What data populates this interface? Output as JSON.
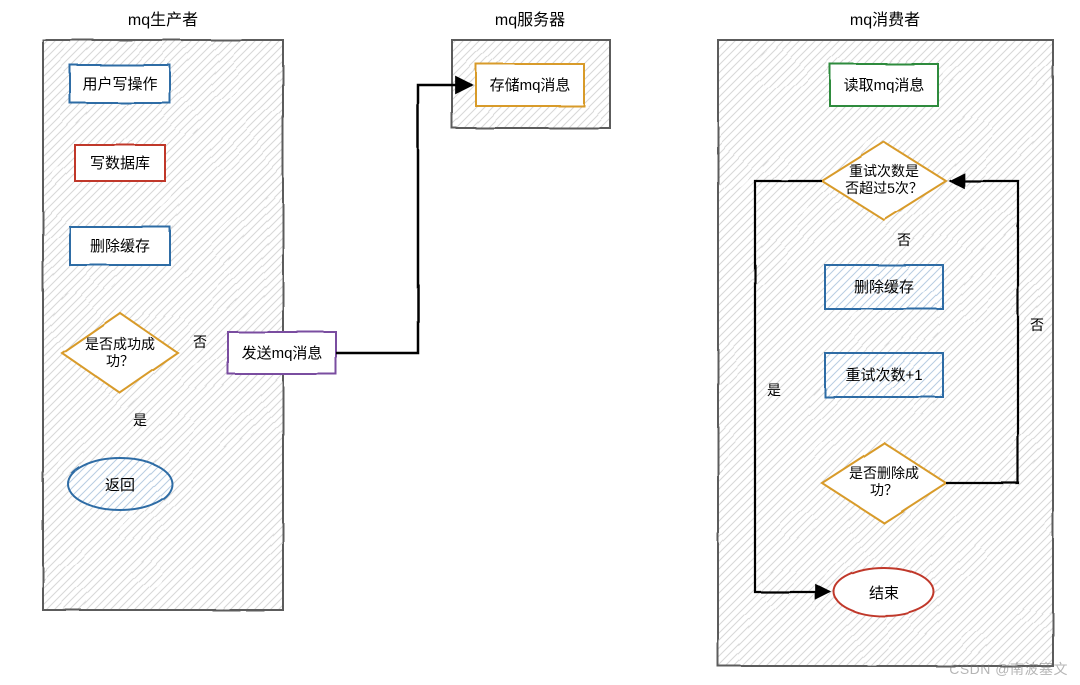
{
  "sections": {
    "producer": {
      "title": "mq生产者"
    },
    "server": {
      "title": "mq服务器"
    },
    "consumer": {
      "title": "mq消费者"
    }
  },
  "producer_nodes": {
    "user_write": "用户写操作",
    "write_db": "写数据库",
    "delete_cache": "删除缓存",
    "decision": "是否成功成\n功？",
    "return": "返回",
    "edge_no": "否",
    "edge_yes": "是",
    "send_mq": "发送mq消息"
  },
  "server_nodes": {
    "store": "存储mq消息"
  },
  "consumer_nodes": {
    "read_mq": "读取mq消息",
    "retry_check": "重试次数是\n否超过5次？",
    "delete_cache": "删除缓存",
    "retry_inc": "重试次数+1",
    "delete_check": "是否删除成\n功？",
    "end": "结束",
    "edge_no": "否",
    "edge_no2": "否",
    "edge_yes": "是"
  },
  "watermark": "CSDN @南波塞文",
  "chart_data": {
    "type": "flowchart",
    "swimlanes": [
      {
        "id": "producer",
        "title": "mq生产者"
      },
      {
        "id": "server",
        "title": "mq服务器"
      },
      {
        "id": "consumer",
        "title": "mq消费者"
      }
    ],
    "nodes": [
      {
        "id": "p1",
        "lane": "producer",
        "shape": "rect",
        "label": "用户写操作",
        "color": "blue"
      },
      {
        "id": "p2",
        "lane": "producer",
        "shape": "rect",
        "label": "写数据库",
        "color": "red"
      },
      {
        "id": "p3",
        "lane": "producer",
        "shape": "rect",
        "label": "删除缓存",
        "color": "blue"
      },
      {
        "id": "p4",
        "lane": "producer",
        "shape": "diamond",
        "label": "是否成功成功？",
        "color": "orange"
      },
      {
        "id": "p5",
        "lane": "producer",
        "shape": "ellipse",
        "label": "返回",
        "color": "blue"
      },
      {
        "id": "p6",
        "lane": "producer",
        "shape": "rect",
        "label": "发送mq消息",
        "color": "purple"
      },
      {
        "id": "s1",
        "lane": "server",
        "shape": "rect",
        "label": "存储mq消息",
        "color": "orange"
      },
      {
        "id": "c1",
        "lane": "consumer",
        "shape": "rect",
        "label": "读取mq消息",
        "color": "green"
      },
      {
        "id": "c2",
        "lane": "consumer",
        "shape": "diamond",
        "label": "重试次数是否超过5次？",
        "color": "orange"
      },
      {
        "id": "c3",
        "lane": "consumer",
        "shape": "rect",
        "label": "删除缓存",
        "color": "blue"
      },
      {
        "id": "c4",
        "lane": "consumer",
        "shape": "rect",
        "label": "重试次数+1",
        "color": "blue"
      },
      {
        "id": "c5",
        "lane": "consumer",
        "shape": "diamond",
        "label": "是否删除成功？",
        "color": "orange"
      },
      {
        "id": "c6",
        "lane": "consumer",
        "shape": "ellipse",
        "label": "结束",
        "color": "red"
      }
    ],
    "edges": [
      {
        "from": "p1",
        "to": "p2"
      },
      {
        "from": "p2",
        "to": "p3"
      },
      {
        "from": "p3",
        "to": "p4"
      },
      {
        "from": "p4",
        "to": "p5",
        "label": "是"
      },
      {
        "from": "p4",
        "to": "p6",
        "label": "否"
      },
      {
        "from": "p6",
        "to": "s1"
      },
      {
        "from": "s1",
        "to": "c1"
      },
      {
        "from": "c1",
        "to": "c2"
      },
      {
        "from": "c2",
        "to": "c3",
        "label": "否"
      },
      {
        "from": "c3",
        "to": "c4"
      },
      {
        "from": "c4",
        "to": "c5"
      },
      {
        "from": "c5",
        "to": "c6",
        "label": "是"
      },
      {
        "from": "c5",
        "to": "c2",
        "label": "否"
      },
      {
        "from": "c2",
        "to": "c6",
        "label": "是"
      }
    ]
  }
}
